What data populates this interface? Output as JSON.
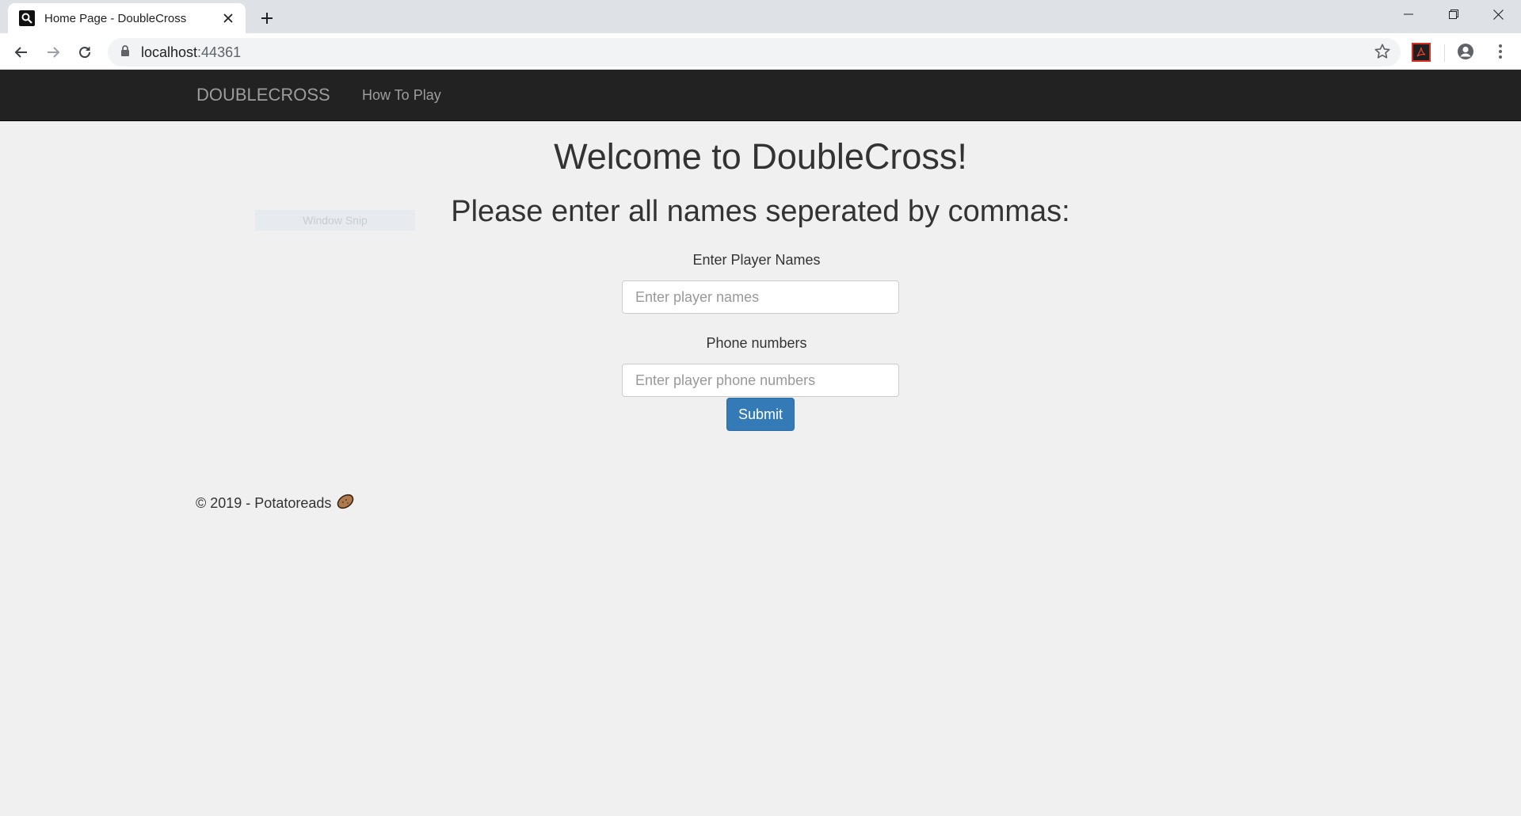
{
  "browser": {
    "tab_title": "Home Page - DoubleCross",
    "url_host": "localhost",
    "url_port": ":44361",
    "icons": [
      "favicon-icon",
      "close-icon",
      "plus-icon",
      "minimize-icon",
      "restore-icon",
      "window-close-icon",
      "back-icon",
      "forward-icon",
      "reload-icon",
      "lock-icon",
      "star-icon",
      "pdf-extension-icon",
      "profile-icon",
      "more-icon"
    ]
  },
  "navbar": {
    "brand": "DOUBLECROSS",
    "links": [
      "How To Play"
    ]
  },
  "overlay": {
    "snip_label": "Window Snip"
  },
  "main": {
    "title": "Welcome to DoubleCross!",
    "subtitle": "Please enter all names seperated by commas:",
    "names_label": "Enter Player Names",
    "names_placeholder": "Enter player names",
    "phones_label": "Phone numbers",
    "phones_placeholder": "Enter player phone numbers",
    "submit_label": "Submit"
  },
  "footer": {
    "text": "© 2019 - Potatoreads"
  },
  "colors": {
    "navbar_bg": "#222222",
    "primary": "#337ab7",
    "page_bg": "#f0f0f0"
  }
}
